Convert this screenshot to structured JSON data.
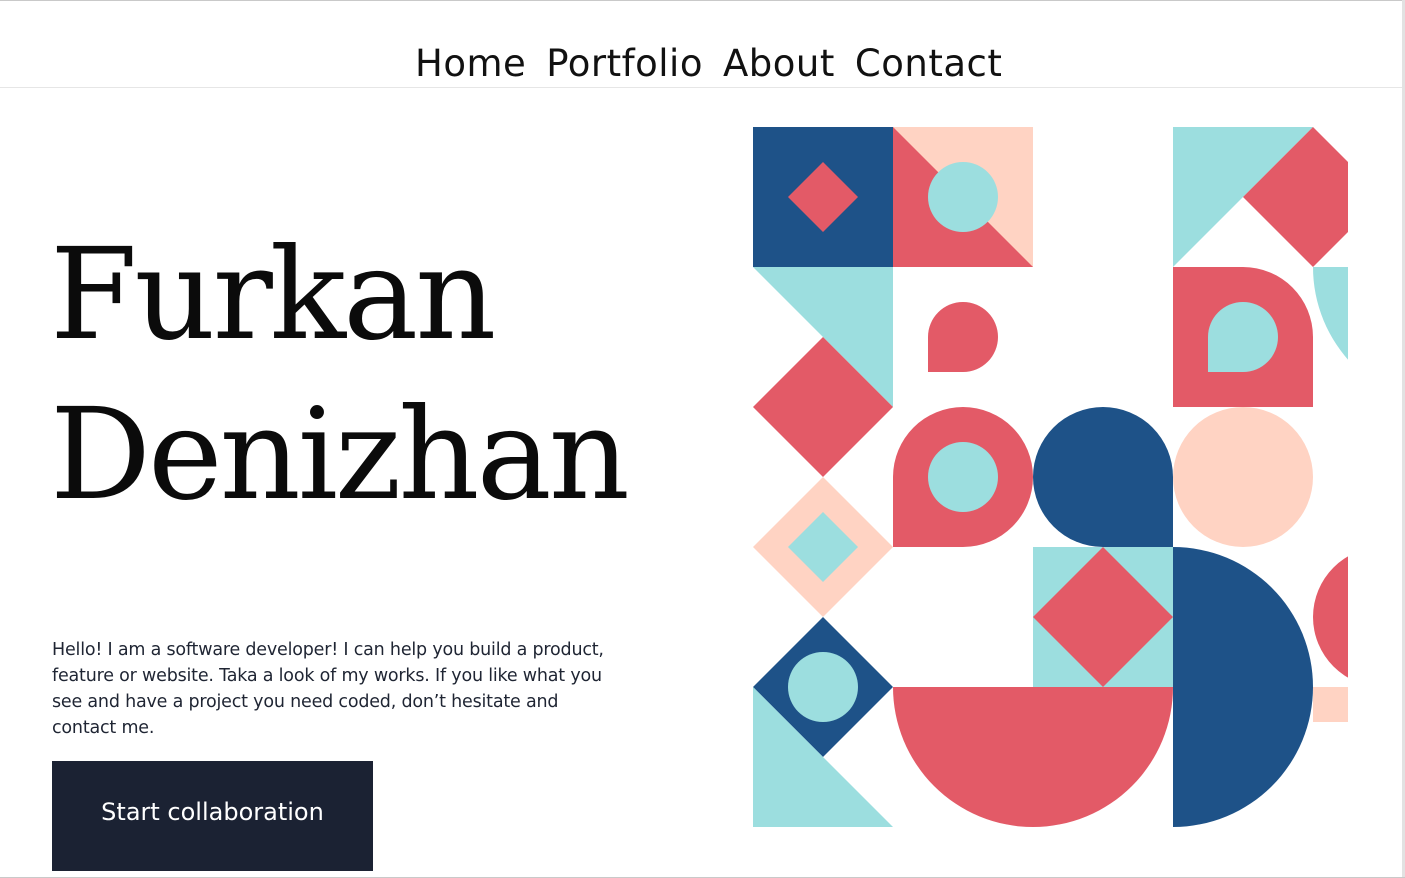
{
  "nav": {
    "items": [
      {
        "label": "Home"
      },
      {
        "label": "Portfolio"
      },
      {
        "label": "About"
      },
      {
        "label": "Contact"
      }
    ]
  },
  "hero": {
    "first_name": "Furkan",
    "last_name": "Denizhan",
    "intro": "Hello! I am a software developer! I can help you build a product, feature or website. Taka a look of my works. If you like what you see and have a project you need coded, don’t hesitate and contact me.",
    "cta_label": "Start collaboration"
  },
  "colors": {
    "navy": "#1e5288",
    "coral": "#e35a67",
    "teal": "#9cdedf",
    "peach": "#ffd3c3",
    "button_bg": "#1b2233",
    "text_dark": "#0b0b0b"
  }
}
